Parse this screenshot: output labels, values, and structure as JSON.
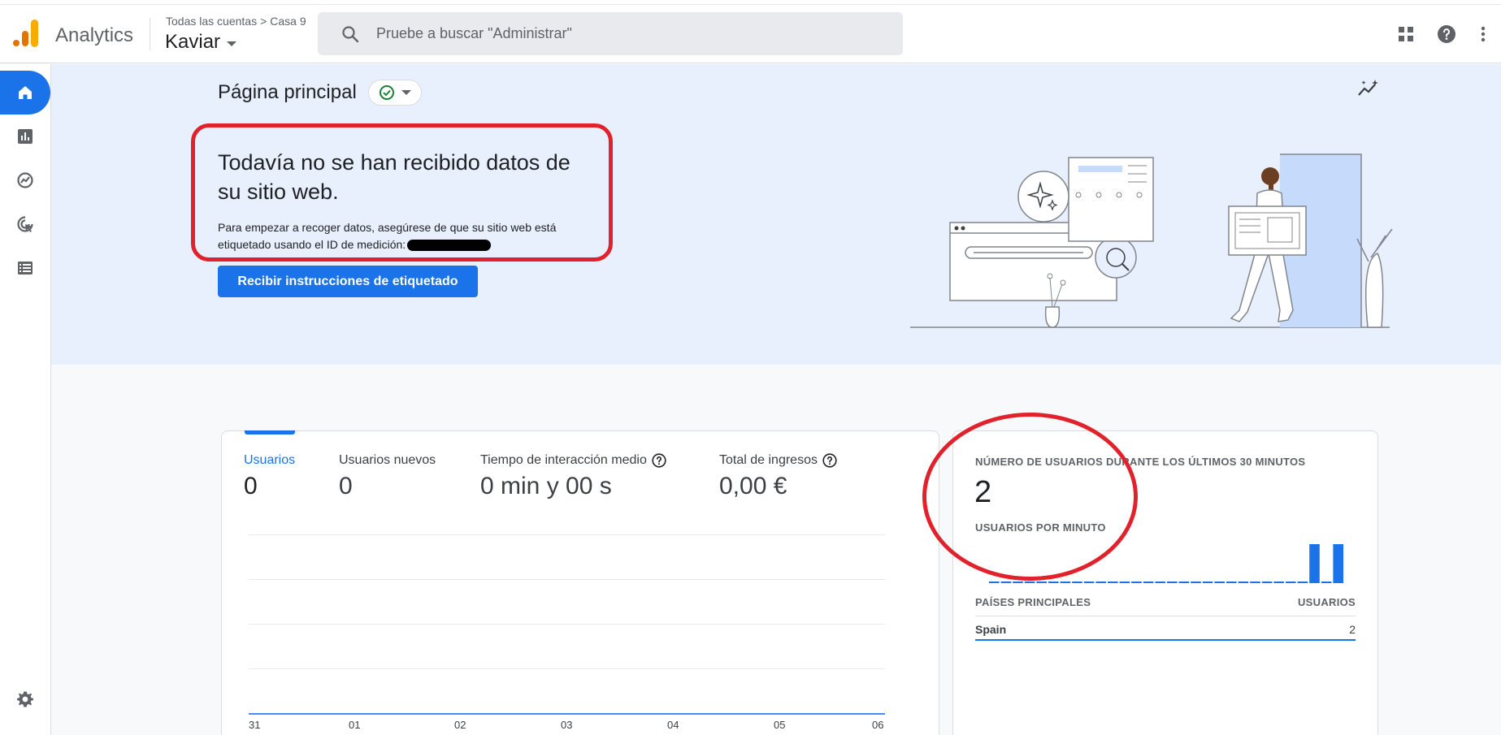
{
  "header": {
    "brand": "Analytics",
    "breadcrumb": [
      "Todas las cuentas",
      ">",
      "Casa 9"
    ],
    "account": "Kaviar",
    "search_placeholder": "Pruebe a buscar \"Administrar\""
  },
  "nav": {
    "items": [
      {
        "name": "home",
        "icon": "home-icon",
        "active": true
      },
      {
        "name": "reports",
        "icon": "bar-chart-icon",
        "active": false
      },
      {
        "name": "explore",
        "icon": "explore-icon",
        "active": false
      },
      {
        "name": "advertising",
        "icon": "target-cursor-icon",
        "active": false
      },
      {
        "name": "configure",
        "icon": "list-icon",
        "active": false
      }
    ],
    "settings_icon": "gear-icon"
  },
  "hero": {
    "title": "Página principal",
    "message_title": "Todavía no se han recibido datos de su sitio web.",
    "message_text": "Para empezar a recoger datos, asegúrese de que su sitio web está etiquetado usando el ID de medición:",
    "button_label": "Recibir instrucciones de etiquetado"
  },
  "metrics": [
    {
      "label": "Usuarios",
      "value": "0",
      "active": true,
      "help": false
    },
    {
      "label": "Usuarios nuevos",
      "value": "0",
      "active": false,
      "help": false
    },
    {
      "label": "Tiempo de interacción medio",
      "value": "0 min y 00 s",
      "active": false,
      "help": true
    },
    {
      "label": "Total de ingresos",
      "value": "0,00 €",
      "active": false,
      "help": true
    }
  ],
  "chart_data": {
    "type": "line",
    "categories": [
      "31",
      "01",
      "02",
      "03",
      "04",
      "05",
      "06"
    ],
    "series": [
      {
        "values": [
          0,
          0,
          0,
          0,
          0,
          0,
          0
        ]
      }
    ]
  },
  "realtime": {
    "title": "NÚMERO DE USUARIOS DURANTE LOS ÚLTIMOS 30 MINUTOS",
    "value": "2",
    "per_minute_label": "USUARIOS POR MINUTO",
    "per_minute_values": [
      0,
      0,
      0,
      0,
      0,
      0,
      0,
      0,
      0,
      0,
      0,
      0,
      0,
      0,
      0,
      0,
      0,
      0,
      0,
      0,
      0,
      0,
      0,
      0,
      0,
      0,
      0,
      1,
      0,
      1
    ],
    "countries_header": "PAÍSES PRINCIPALES",
    "users_header": "USUARIOS",
    "countries": [
      {
        "name": "Spain",
        "value": "2"
      }
    ]
  },
  "colors": {
    "accent": "#1a73e8",
    "annotation": "#e1212b",
    "hero_bg": "#e8f0fe"
  }
}
